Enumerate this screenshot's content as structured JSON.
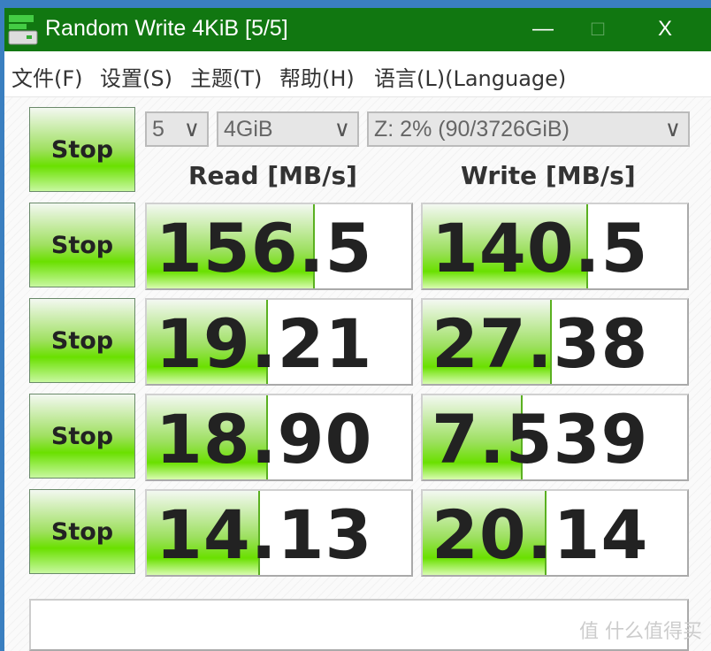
{
  "window": {
    "title": "Random Write 4KiB [5/5]",
    "minimize": "—",
    "maximize": "□",
    "close": "X"
  },
  "menu": [
    {
      "label": "文件(F)"
    },
    {
      "label": "设置(S)"
    },
    {
      "label": "主题(T)"
    },
    {
      "label": "帮助(H)"
    },
    {
      "label": "语言(L)(Language)"
    }
  ],
  "controls": {
    "all_button": "Stop",
    "count": "5",
    "size": "4GiB",
    "drive": "Z: 2% (90/3726GiB)"
  },
  "headers": {
    "read": "Read [MB/s]",
    "write": "Write [MB/s]"
  },
  "rows": [
    {
      "button": "Stop",
      "read": "156.5",
      "read_fill": 0.63,
      "write": "140.5",
      "write_fill": 0.62
    },
    {
      "button": "Stop",
      "read": "19.21",
      "read_fill": 0.45,
      "write": "27.38",
      "write_fill": 0.48
    },
    {
      "button": "Stop",
      "read": "18.90",
      "read_fill": 0.45,
      "write": "7.539",
      "write_fill": 0.37
    },
    {
      "button": "Stop",
      "read": "14.13",
      "read_fill": 0.42,
      "write": "20.14",
      "write_fill": 0.46
    }
  ],
  "status": "",
  "watermark": "值 什么值得买",
  "colors": {
    "titlebar": "#117711",
    "accent": "#6ae000"
  }
}
